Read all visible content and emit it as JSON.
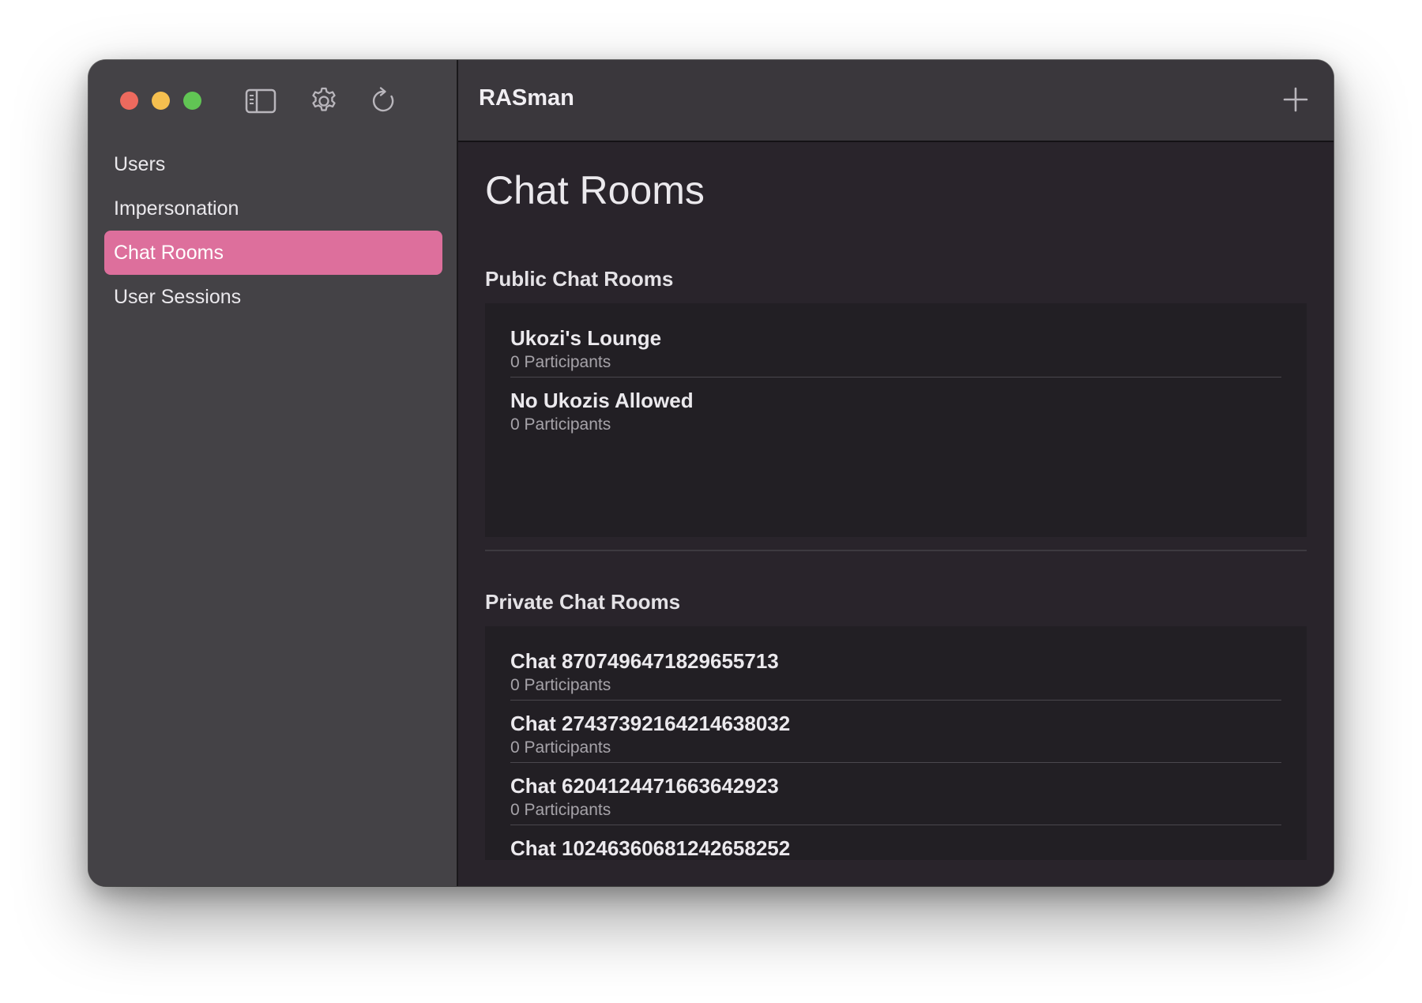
{
  "app": {
    "title": "RASman"
  },
  "toolbar": {
    "icons": [
      "sidebar-toggle-icon",
      "gear-icon",
      "refresh-icon"
    ],
    "add_icon": "plus-icon"
  },
  "sidebar": {
    "items": [
      {
        "label": "Users",
        "selected": false
      },
      {
        "label": "Impersonation",
        "selected": false
      },
      {
        "label": "Chat Rooms",
        "selected": true
      },
      {
        "label": "User Sessions",
        "selected": false
      }
    ],
    "selected_color": "#dd6f9c"
  },
  "main": {
    "title": "Chat Rooms",
    "public": {
      "heading": "Public Chat Rooms",
      "rooms": [
        {
          "name": "Ukozi's Lounge",
          "participants": "0 Participants"
        },
        {
          "name": "No Ukozis Allowed",
          "participants": "0 Participants"
        }
      ]
    },
    "private": {
      "heading": "Private Chat Rooms",
      "rooms": [
        {
          "name": "Chat 8707496471829655713",
          "participants": "0 Participants"
        },
        {
          "name": "Chat 2743739216421463803​2",
          "participants": "0 Participants"
        },
        {
          "name": "Chat 6204124471663642923",
          "participants": "0 Participants"
        },
        {
          "name": "Chat 10246360681242658252",
          "participants": ""
        }
      ]
    }
  },
  "colors": {
    "traffic_close": "#ed6a5e",
    "traffic_minimize": "#f5bf4f",
    "traffic_zoom": "#61c554"
  }
}
